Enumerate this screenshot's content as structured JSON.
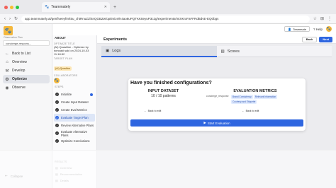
{
  "browser": {
    "tab_title": "Teammately",
    "url": "app.teammately.ai/genfiveeyfm/t5u_chtRnuZ2lSnQGBZw/optimize/K4ao8uPQTKKtteyuP3c2g/experiments/mtXKrxFaFFRdBdvE-EQ0bgs",
    "colors": {
      "light_red": "#f25f57",
      "light_yellow": "#f6bd2f",
      "light_green": "#28c840"
    }
  },
  "sidebar": {
    "workspace_label": "Observation Plan",
    "select_value": "concierge-respons...",
    "nav": [
      {
        "icon": "arrow-left-icon",
        "label": "Back to List"
      },
      {
        "icon": "home-icon",
        "label": "Overview"
      },
      {
        "icon": "build-icon",
        "label": "Develop"
      },
      {
        "icon": "gear-icon",
        "label": "Optimize"
      },
      {
        "icon": "eye-icon",
        "label": "Observe"
      }
    ],
    "footer": "Collapse"
  },
  "about": {
    "title": "ABOUT",
    "optimize_label": "OPTIMIZE TITLE",
    "optimize_value": "(AI) Quasiline - Optimize by tomoaki saki on 2024-10-03 11:18:52",
    "target_label": "TARGET PLAN",
    "target_badge": "(AI) Quasiline",
    "collaborators_label": "COLLABORATORS",
    "steps_label": "STEPS",
    "steps": [
      "Initialize",
      "Create Input Dataset",
      "Create Eval Metrics",
      "Evaluate Target Plan",
      "Review Alternative Plans",
      "Evaluate Alternative Plans",
      "Optimize Conclusions"
    ],
    "results_label": "RESULTS",
    "results": [
      "Overview",
      "Recommendation",
      "Details"
    ]
  },
  "top_right": {
    "team_label": "Teammate",
    "help_label": "Help"
  },
  "main": {
    "title": "Experiments",
    "back_label": "Back",
    "next_label": "Next",
    "tabs": [
      {
        "icon": "logs-icon",
        "label": "Logs"
      },
      {
        "icon": "scores-icon",
        "label": "Scores"
      }
    ]
  },
  "modal": {
    "title": "Have you finished configurations?",
    "input_heading": "INPUT DATASET",
    "input_value": "10 / 10 patterns",
    "eval_heading": "EVALUATION METRICS",
    "metric_name": "concierge_response",
    "metric_tags": [
      "Brand Consistency",
      "Relevant Information",
      "Courtesy and Etiquette"
    ],
    "back_to_edit_left": "Back to edit",
    "back_to_edit_right": "Back to edit",
    "start_label": "Start Evaluation"
  }
}
